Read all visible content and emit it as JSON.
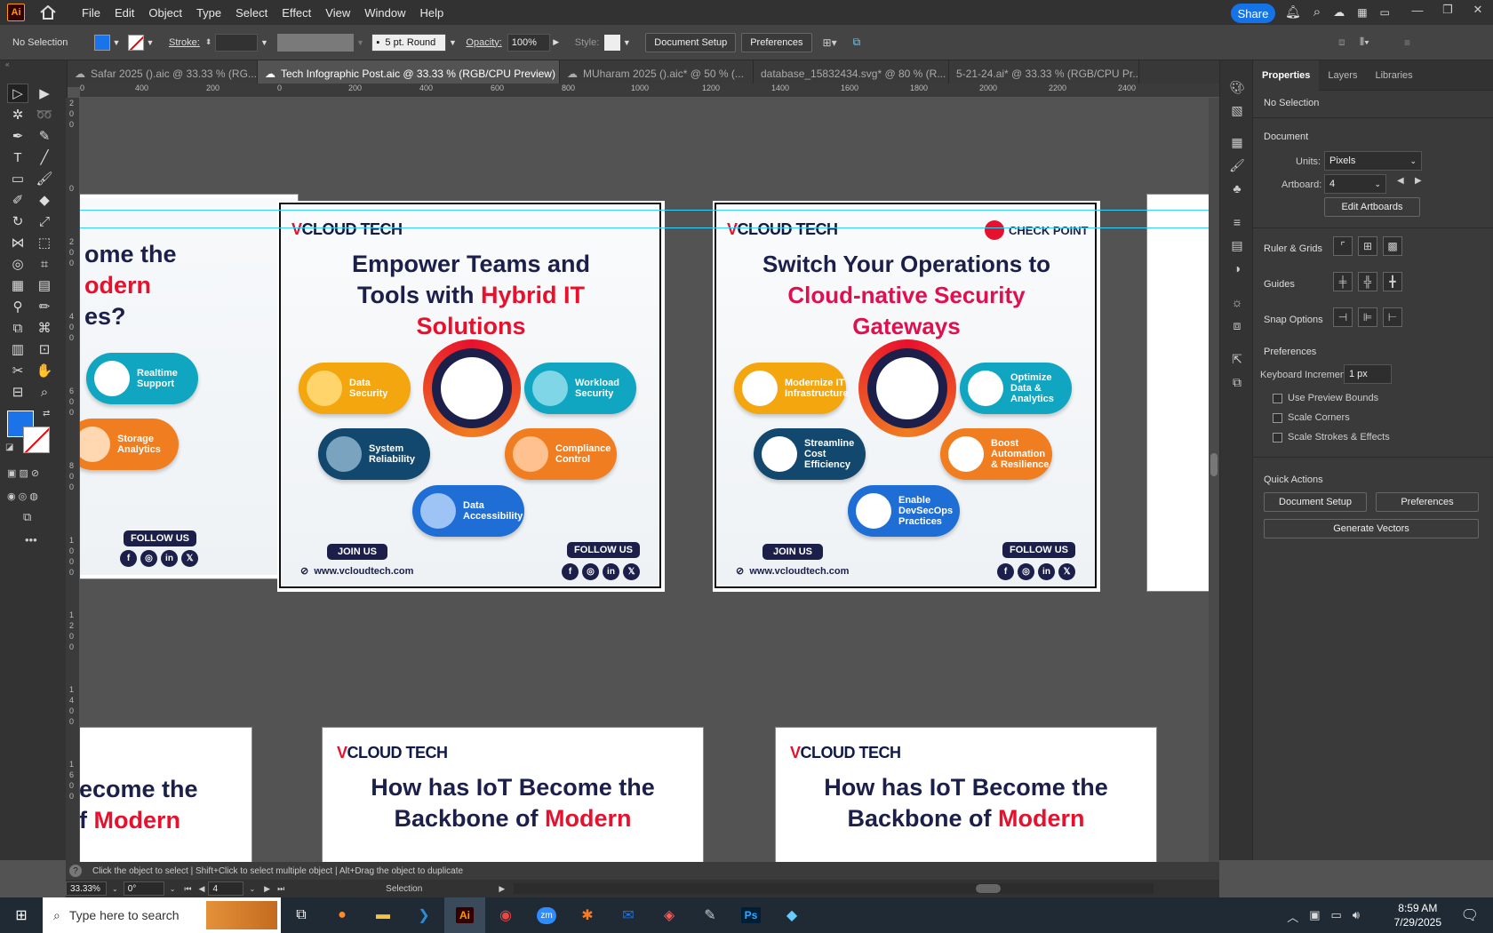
{
  "app": {
    "logo": "Ai",
    "menus": [
      "File",
      "Edit",
      "Object",
      "Type",
      "Select",
      "Effect",
      "View",
      "Window",
      "Help"
    ],
    "share": "Share"
  },
  "control": {
    "selection": "No Selection",
    "stroke_label": "Stroke:",
    "brush": "5 pt. Round",
    "opacity_label": "Opacity:",
    "opacity": "100%",
    "style_label": "Style:",
    "doc_setup": "Document Setup",
    "preferences": "Preferences",
    "fill_color": "#1a73e8"
  },
  "tabs": [
    {
      "label": "Safar 2025 ().aic @ 33.33 % (RG..."
    },
    {
      "label": "Tech Infographic Post.aic @ 33.33 % (RGB/CPU Preview)"
    },
    {
      "label": "MUharam 2025 ().aic* @ 50 % (..."
    },
    {
      "label": "database_15832434.svg* @ 80 % (R..."
    },
    {
      "label": "5-21-24.ai* @ 33.33 % (RGB/CPU Pr..."
    }
  ],
  "ruler": {
    "h": [
      "0",
      "400",
      "200",
      "0",
      "200",
      "400",
      "600",
      "800",
      "1000",
      "1200",
      "1400",
      "1600",
      "1800",
      "2000",
      "2200",
      "2400"
    ],
    "v": [
      "2",
      "0",
      "0",
      "0",
      "2",
      "0",
      "0",
      "4",
      "0",
      "0",
      "6",
      "0",
      "0",
      "8",
      "0",
      "0",
      "1",
      "0",
      "0",
      "0",
      "1",
      "2",
      "0",
      "0",
      "1",
      "4",
      "0",
      "0",
      "1",
      "6",
      "0",
      "0"
    ]
  },
  "art1": {
    "brand_v": "V",
    "brand": "CLOUD TECH",
    "title_a": "Empower Teams and",
    "title_b": "Tools with ",
    "title_red": "Hybrid IT",
    "title_c": "Solutions",
    "pills": [
      "Data Security",
      "Workload Security",
      "System Reliability",
      "Compliance Control",
      "Data Accessibility"
    ],
    "join": "JOIN US",
    "follow": "FOLLOW US",
    "web": "www.vcloudtech.com"
  },
  "art2": {
    "brand_v": "V",
    "brand": "CLOUD TECH",
    "partner": "CHECK POINT",
    "title_a": "Switch Your Operations to",
    "title_red1": "Cloud-native Security",
    "title_red2": "Gateways",
    "pills": [
      "Modernize IT Infrastructure",
      "Optimize Data & Analytics",
      "Streamline Cost Efficiency",
      "Boost Automation & Resilience",
      "Enable DevSecOps Practices"
    ],
    "join": "JOIN US",
    "follow": "FOLLOW US",
    "web": "www.vcloudtech.com"
  },
  "art0": {
    "t1": "ome the",
    "t2": "odern",
    "t3": "es?",
    "p1": "Realtime Support",
    "p2": "Storage Analytics",
    "follow": "FOLLOW US"
  },
  "art_bottom": {
    "brand_v": "V",
    "brand": "CLOUD TECH",
    "title_a": "How has IoT Become the",
    "title_b": "Backbone of ",
    "title_red": "Modern",
    "left_a": "ecome the",
    "left_b": "f ",
    "left_red": "Modern"
  },
  "social": [
    "f",
    "◎",
    "in",
    "𝕏"
  ],
  "props": {
    "tabs": [
      "Properties",
      "Layers",
      "Libraries"
    ],
    "selection": "No Selection",
    "document": "Document",
    "units_label": "Units:",
    "units": "Pixels",
    "artboard_label": "Artboard:",
    "artboard": "4",
    "edit_artboards": "Edit Artboards",
    "ruler_grids": "Ruler & Grids",
    "guides": "Guides",
    "snap": "Snap Options",
    "preferences": "Preferences",
    "keyinc_label": "Keyboard Increment:",
    "keyinc": "1 px",
    "checks": [
      "Use Preview Bounds",
      "Scale Corners",
      "Scale Strokes & Effects"
    ],
    "quick": "Quick Actions",
    "doc_setup": "Document Setup",
    "prefs": "Preferences",
    "gen_vectors": "Generate Vectors"
  },
  "status": {
    "hint": "Click the object to select  |  Shift+Click to select multiple object  |  Alt+Drag the object to duplicate",
    "zoom": "33.33%",
    "angle": "0°",
    "artboard": "4",
    "mode": "Selection"
  },
  "taskbar": {
    "search": "Type here to search",
    "time": "8:59 AM",
    "date": "7/29/2025"
  }
}
